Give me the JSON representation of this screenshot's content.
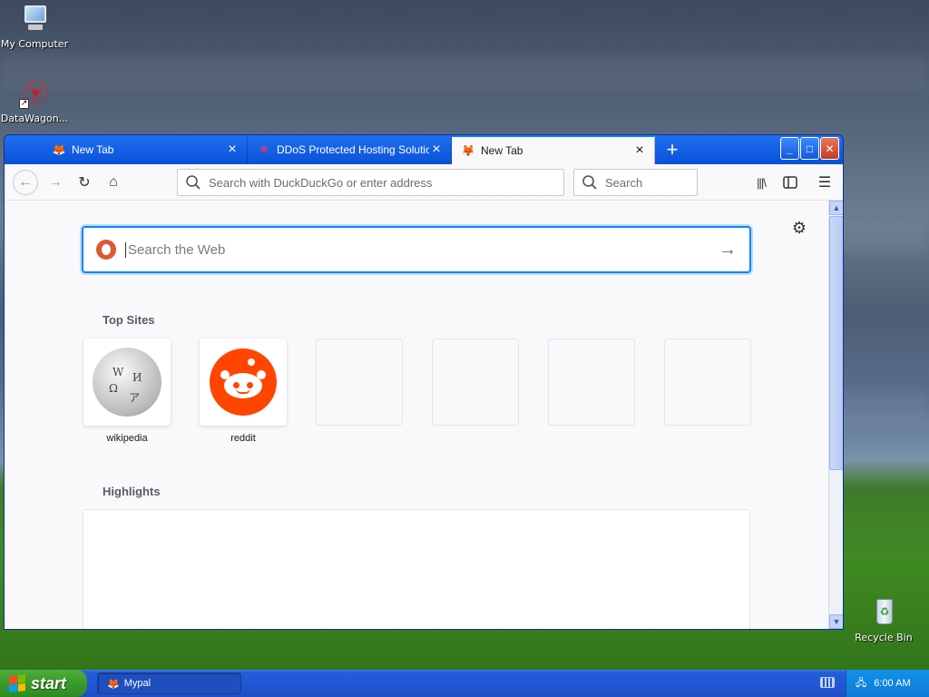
{
  "desktop": {
    "icons": [
      {
        "label": "My Computer"
      },
      {
        "label": "DataWagon..."
      },
      {
        "label": "Recycle Bin"
      }
    ]
  },
  "browser": {
    "tabs": [
      {
        "title": "New Tab",
        "active": false
      },
      {
        "title": "DDoS Protected Hosting Solutions",
        "active": false
      },
      {
        "title": "New Tab",
        "active": true
      }
    ],
    "url_placeholder": "Search with DuckDuckGo or enter address",
    "search_placeholder": "Search",
    "page": {
      "web_search_placeholder": "Search the Web",
      "top_sites_title": "Top Sites",
      "top_sites": [
        {
          "label": "wikipedia",
          "icon": "wikipedia-globe-icon"
        },
        {
          "label": "reddit",
          "icon": "reddit-alien-icon"
        },
        {
          "label": ""
        },
        {
          "label": ""
        },
        {
          "label": ""
        },
        {
          "label": ""
        }
      ],
      "highlights_title": "Highlights"
    },
    "accent_color": "#0a84ff"
  },
  "taskbar": {
    "start_label": "start",
    "task_label": "Mypal",
    "clock": "6:00 AM"
  }
}
